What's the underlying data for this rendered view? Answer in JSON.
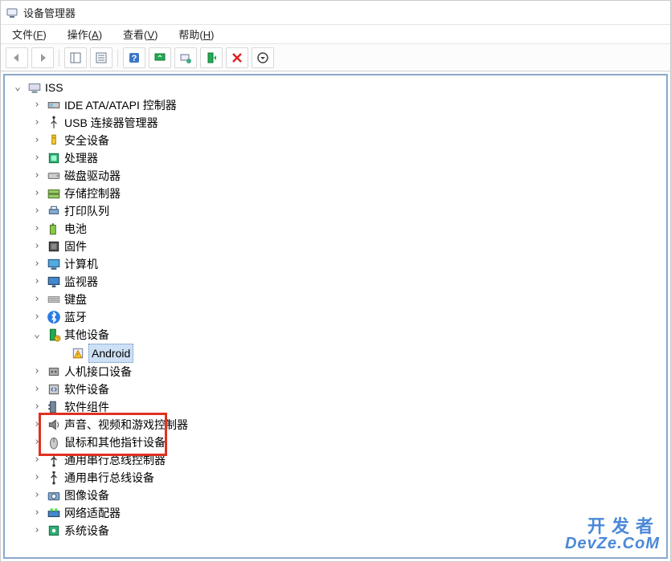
{
  "window": {
    "title": "设备管理器"
  },
  "menus": {
    "file": {
      "label": "文件",
      "key": "F"
    },
    "action": {
      "label": "操作",
      "key": "A"
    },
    "view": {
      "label": "查看",
      "key": "V"
    },
    "help": {
      "label": "帮助",
      "key": "H"
    }
  },
  "toolbar_icons": [
    "back",
    "forward",
    "up",
    "properties",
    "help",
    "scan",
    "monitor",
    "update",
    "uninstall",
    "more"
  ],
  "root": {
    "label": "ISS"
  },
  "nodes": [
    {
      "id": "ide",
      "label": "IDE ATA/ATAPI 控制器",
      "icon": "ide-icon"
    },
    {
      "id": "usb-conn",
      "label": "USB 连接器管理器",
      "icon": "usb-conn-icon"
    },
    {
      "id": "security",
      "label": "安全设备",
      "icon": "security-icon"
    },
    {
      "id": "cpu",
      "label": "处理器",
      "icon": "cpu-icon"
    },
    {
      "id": "disk",
      "label": "磁盘驱动器",
      "icon": "disk-icon"
    },
    {
      "id": "storage",
      "label": "存储控制器",
      "icon": "storage-icon"
    },
    {
      "id": "printq",
      "label": "打印队列",
      "icon": "printer-icon"
    },
    {
      "id": "battery",
      "label": "电池",
      "icon": "battery-icon"
    },
    {
      "id": "firmware",
      "label": "固件",
      "icon": "firmware-icon"
    },
    {
      "id": "computer",
      "label": "计算机",
      "icon": "computer-icon"
    },
    {
      "id": "monitor",
      "label": "监视器",
      "icon": "monitor-icon"
    },
    {
      "id": "keyboard",
      "label": "键盘",
      "icon": "keyboard-icon"
    },
    {
      "id": "bluetooth",
      "label": "蓝牙",
      "icon": "bluetooth-icon"
    },
    {
      "id": "other",
      "label": "其他设备",
      "icon": "other-icon",
      "expanded": true,
      "children": [
        {
          "id": "android",
          "label": "Android",
          "icon": "warning-icon",
          "selected": true
        }
      ]
    },
    {
      "id": "hid",
      "label": "人机接口设备",
      "icon": "hid-icon"
    },
    {
      "id": "swdev",
      "label": "软件设备",
      "icon": "swdev-icon"
    },
    {
      "id": "swcomp",
      "label": "软件组件",
      "icon": "swcomp-icon"
    },
    {
      "id": "sound",
      "label": "声音、视频和游戏控制器",
      "icon": "sound-icon"
    },
    {
      "id": "mouse",
      "label": "鼠标和其他指针设备",
      "icon": "mouse-icon"
    },
    {
      "id": "usbctrl",
      "label": "通用串行总线控制器",
      "icon": "usb-icon"
    },
    {
      "id": "usbdev",
      "label": "通用串行总线设备",
      "icon": "usb-icon"
    },
    {
      "id": "imaging",
      "label": "图像设备",
      "icon": "camera-icon"
    },
    {
      "id": "network",
      "label": "网络适配器",
      "icon": "network-icon"
    },
    {
      "id": "system",
      "label": "系统设备",
      "icon": "system-icon"
    }
  ],
  "watermark": {
    "zh": "开发者",
    "en": "DevZe.CoM"
  }
}
